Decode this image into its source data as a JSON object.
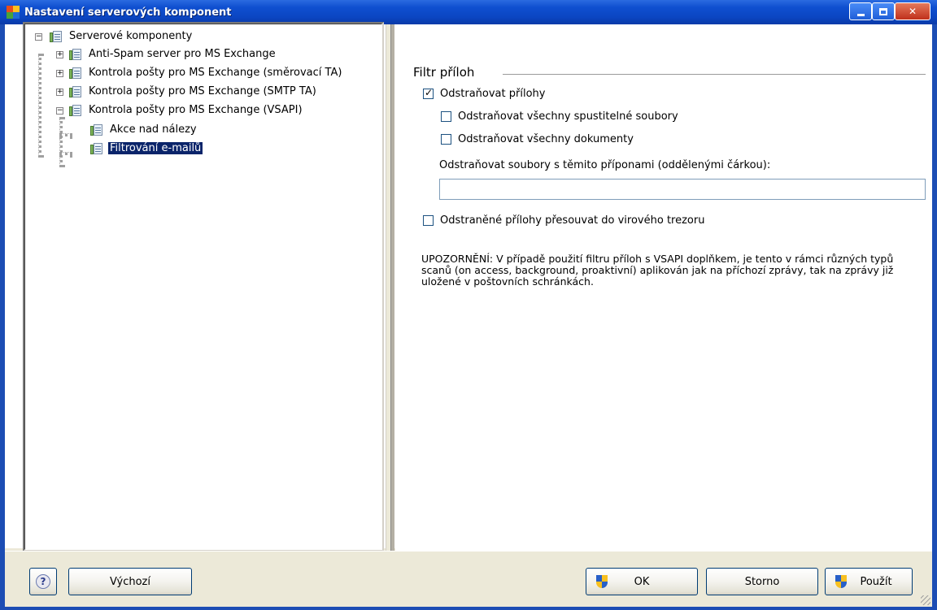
{
  "window": {
    "title": "Nastavení serverových komponent"
  },
  "tree": {
    "items": [
      {
        "label": "Serverové komponenty",
        "expanded": true
      },
      {
        "label": "Anti-Spam server pro MS Exchange",
        "expanded": false
      },
      {
        "label": "Kontrola pošty pro MS Exchange (směrovací TA)",
        "expanded": false
      },
      {
        "label": "Kontrola pošty pro MS Exchange (SMTP TA)",
        "expanded": false
      },
      {
        "label": "Kontrola pošty pro MS Exchange (VSAPI)",
        "expanded": true
      },
      {
        "label": "Akce nad nálezy"
      },
      {
        "label": "Filtrování e-mailů",
        "selected": true
      }
    ]
  },
  "panel": {
    "group_title": "Filtr příloh",
    "remove_attachments": {
      "label": "Odstraňovat přílohy",
      "checked": true
    },
    "remove_executables": {
      "label": "Odstraňovat všechny spustitelné soubory",
      "checked": false
    },
    "remove_documents": {
      "label": "Odstraňovat všechny dokumenty",
      "checked": false
    },
    "extensions_label": "Odstraňovat soubory s těmito příponami (oddělenými čárkou):",
    "extensions_value": "",
    "move_to_vault": {
      "label": "Odstraněné přílohy přesouvat do virového trezoru",
      "checked": false
    },
    "notice": "UPOZORNĚNÍ: V případě použití filtru příloh s VSAPI doplňkem, je tento v rámci různých typů scanů (on access, background, proaktivní) aplikován jak na příchozí zprávy, tak na zprávy již uložené v poštovních schránkách."
  },
  "buttons": {
    "help": "?",
    "default": "Výchozí",
    "ok": "OK",
    "cancel": "Storno",
    "apply": "Použít"
  },
  "colors": {
    "titlebar": "#0b46c2",
    "selection": "#0a246a",
    "dialog_bg": "#ece9d8"
  }
}
